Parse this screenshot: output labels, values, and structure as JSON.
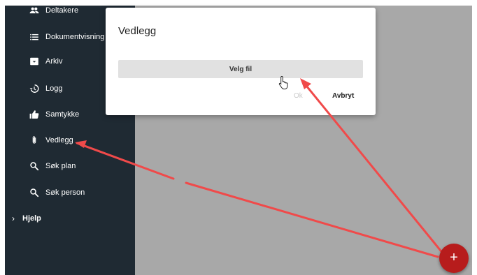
{
  "sidebar": {
    "items": [
      {
        "label": "Deltakere",
        "icon": "people-icon"
      },
      {
        "label": "Dokumentvisning",
        "icon": "list-icon"
      },
      {
        "label": "Arkiv",
        "icon": "archive-icon"
      },
      {
        "label": "Logg",
        "icon": "history-icon"
      },
      {
        "label": "Samtykke",
        "icon": "thumb-up-icon"
      },
      {
        "label": "Vedlegg",
        "icon": "paperclip-icon"
      },
      {
        "label": "Søk plan",
        "icon": "search-icon"
      },
      {
        "label": "Søk person",
        "icon": "search-icon"
      }
    ],
    "help": {
      "label": "Hjelp",
      "icon": "chevron-right-icon"
    }
  },
  "dialog": {
    "title": "Vedlegg",
    "pick_file_label": "Velg fil",
    "ok_label": "Ok",
    "cancel_label": "Avbryt"
  },
  "fab": {
    "label": "+",
    "color": "#b71c1c"
  },
  "annotation": {
    "arrow_color": "#f04a4a"
  },
  "colors": {
    "sidebar": "#1f2a33",
    "backdrop": "#a8a8a8"
  }
}
